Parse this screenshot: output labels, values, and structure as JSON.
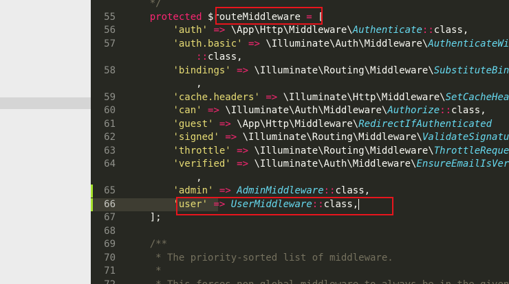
{
  "gutter": [
    {
      "num": "",
      "active": false,
      "mod": false
    },
    {
      "num": "55",
      "active": false,
      "mod": false
    },
    {
      "num": "56",
      "active": false,
      "mod": false
    },
    {
      "num": "57",
      "active": false,
      "mod": false
    },
    {
      "num": "",
      "active": false,
      "mod": false
    },
    {
      "num": "58",
      "active": false,
      "mod": false
    },
    {
      "num": "",
      "active": false,
      "mod": false
    },
    {
      "num": "59",
      "active": false,
      "mod": false
    },
    {
      "num": "60",
      "active": false,
      "mod": false
    },
    {
      "num": "61",
      "active": false,
      "mod": false
    },
    {
      "num": "62",
      "active": false,
      "mod": false
    },
    {
      "num": "63",
      "active": false,
      "mod": false
    },
    {
      "num": "64",
      "active": false,
      "mod": false
    },
    {
      "num": "",
      "active": false,
      "mod": false
    },
    {
      "num": "65",
      "active": false,
      "mod": true
    },
    {
      "num": "66",
      "active": true,
      "mod": true
    },
    {
      "num": "67",
      "active": false,
      "mod": false
    },
    {
      "num": "68",
      "active": false,
      "mod": false
    },
    {
      "num": "69",
      "active": false,
      "mod": false
    },
    {
      "num": "70",
      "active": false,
      "mod": false
    },
    {
      "num": "71",
      "active": false,
      "mod": false
    },
    {
      "num": "72",
      "active": false,
      "mod": false
    }
  ],
  "code": [
    [
      [
        "com",
        "    */"
      ]
    ],
    [
      [
        "",
        "    "
      ],
      [
        "kw",
        "protected"
      ],
      [
        "",
        " $routeMiddleware "
      ],
      [
        "kw",
        "="
      ],
      [
        "",
        " ["
      ]
    ],
    [
      [
        "",
        "        "
      ],
      [
        "str",
        "'auth'"
      ],
      [
        "",
        " "
      ],
      [
        "kw",
        "=>"
      ],
      [
        "",
        " \\App\\Http\\Middleware\\"
      ],
      [
        "cls",
        "Authenticate"
      ],
      [
        "kw",
        "::"
      ],
      [
        "",
        "class,"
      ]
    ],
    [
      [
        "",
        "        "
      ],
      [
        "str",
        "'auth.basic'"
      ],
      [
        "",
        " "
      ],
      [
        "kw",
        "=>"
      ],
      [
        "",
        " \\Illuminate\\Auth\\Middleware\\"
      ],
      [
        "cls",
        "AuthenticateWithBasicAuth"
      ]
    ],
    [
      [
        "",
        "            "
      ],
      [
        "kw",
        "::"
      ],
      [
        "",
        "class,"
      ]
    ],
    [
      [
        "",
        "        "
      ],
      [
        "str",
        "'bindings'"
      ],
      [
        "",
        " "
      ],
      [
        "kw",
        "=>"
      ],
      [
        "",
        " \\Illuminate\\Routing\\Middleware\\"
      ],
      [
        "cls",
        "SubstituteBindings"
      ]
    ],
    [
      [
        "",
        "            ,"
      ]
    ],
    [
      [
        "",
        "        "
      ],
      [
        "str",
        "'cache.headers'"
      ],
      [
        "",
        " "
      ],
      [
        "kw",
        "=>"
      ],
      [
        "",
        " \\Illuminate\\Http\\Middleware\\"
      ],
      [
        "cls",
        "SetCacheHeaders"
      ]
    ],
    [
      [
        "",
        "        "
      ],
      [
        "str",
        "'can'"
      ],
      [
        "",
        " "
      ],
      [
        "kw",
        "=>"
      ],
      [
        "",
        " \\Illuminate\\Auth\\Middleware\\"
      ],
      [
        "cls",
        "Authorize"
      ],
      [
        "kw",
        "::"
      ],
      [
        "",
        "class,"
      ]
    ],
    [
      [
        "",
        "        "
      ],
      [
        "str",
        "'guest'"
      ],
      [
        "",
        " "
      ],
      [
        "kw",
        "=>"
      ],
      [
        "",
        " \\App\\Http\\Middleware\\"
      ],
      [
        "cls",
        "RedirectIfAuthenticated"
      ]
    ],
    [
      [
        "",
        "        "
      ],
      [
        "str",
        "'signed'"
      ],
      [
        "",
        " "
      ],
      [
        "kw",
        "=>"
      ],
      [
        "",
        " \\Illuminate\\Routing\\Middleware\\"
      ],
      [
        "cls",
        "ValidateSignature"
      ]
    ],
    [
      [
        "",
        "        "
      ],
      [
        "str",
        "'throttle'"
      ],
      [
        "",
        " "
      ],
      [
        "kw",
        "=>"
      ],
      [
        "",
        " \\Illuminate\\Routing\\Middleware\\"
      ],
      [
        "cls",
        "ThrottleRequests"
      ]
    ],
    [
      [
        "",
        "        "
      ],
      [
        "str",
        "'verified'"
      ],
      [
        "",
        " "
      ],
      [
        "kw",
        "=>"
      ],
      [
        "",
        " \\Illuminate\\Auth\\Middleware\\"
      ],
      [
        "cls",
        "EnsureEmailIsVerified"
      ]
    ],
    [
      [
        "",
        "            ,"
      ]
    ],
    [
      [
        "",
        "        "
      ],
      [
        "str",
        "'admin'"
      ],
      [
        "",
        " "
      ],
      [
        "kw",
        "=>"
      ],
      [
        "",
        " "
      ],
      [
        "cls",
        "AdminMiddleware"
      ],
      [
        "kw",
        "::"
      ],
      [
        "",
        "class,"
      ]
    ],
    [
      [
        "",
        "        "
      ],
      [
        "str",
        "'user'"
      ],
      [
        "",
        " "
      ],
      [
        "kw",
        "=>"
      ],
      [
        "",
        " "
      ],
      [
        "cls",
        "UserMiddleware"
      ],
      [
        "kw",
        "::"
      ],
      [
        "",
        "class,"
      ],
      [
        "cursor",
        ""
      ]
    ],
    [
      [
        "",
        "    ];"
      ]
    ],
    [
      [
        "",
        ""
      ]
    ],
    [
      [
        "com",
        "    /**"
      ]
    ],
    [
      [
        "com",
        "     * The priority-sorted list of middleware."
      ]
    ],
    [
      [
        "com",
        "     *"
      ]
    ],
    [
      [
        "com",
        "     * This forces non-global middleware to always be in the given order."
      ]
    ]
  ],
  "colors": {
    "editor_bg": "#272822",
    "keyword": "#f92672",
    "string": "#e6db74",
    "class": "#66d9ef",
    "comment": "#75715e",
    "highlight_box": "#e8151d"
  }
}
